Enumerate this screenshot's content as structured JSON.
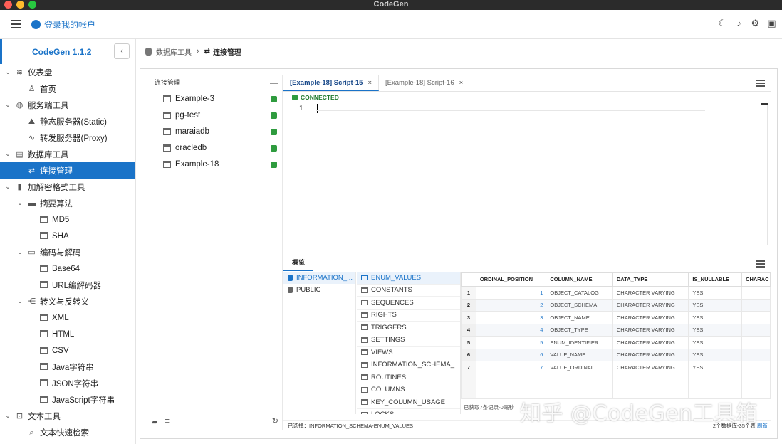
{
  "window": {
    "title": "CodeGen"
  },
  "colors": {
    "accent": "#1a73c8",
    "connected": "#2e9b3e"
  },
  "topbar": {
    "login_label": "登录我的帐户"
  },
  "sidebar": {
    "version": "CodeGen 1.1.2",
    "items": [
      {
        "label": "仪表盘",
        "level": 0,
        "icon": "layers-icon",
        "expanded": true
      },
      {
        "label": "首页",
        "level": 1,
        "icon": "user-icon"
      },
      {
        "label": "服务端工具",
        "level": 0,
        "icon": "globe-icon",
        "expanded": true
      },
      {
        "label": "静态服务器(Static)",
        "level": 1,
        "icon": "mountain-icon"
      },
      {
        "label": "转发服务器(Proxy)",
        "level": 1,
        "icon": "pulse-icon"
      },
      {
        "label": "数据库工具",
        "level": 0,
        "icon": "database-icon",
        "expanded": true
      },
      {
        "label": "连接管理",
        "level": 1,
        "icon": "swap-icon",
        "active": true
      },
      {
        "label": "加解密格式工具",
        "level": 0,
        "icon": "lock-icon",
        "expanded": true
      },
      {
        "label": "摘要算法",
        "level": 1,
        "icon": "key-icon",
        "expanded": true
      },
      {
        "label": "MD5",
        "level": 2,
        "icon": "document-icon"
      },
      {
        "label": "SHA",
        "level": 2,
        "icon": "document-icon"
      },
      {
        "label": "编码与解码",
        "level": 1,
        "icon": "keyboard-icon",
        "expanded": true
      },
      {
        "label": "Base64",
        "level": 2,
        "icon": "document-icon"
      },
      {
        "label": "URL编解码器",
        "level": 2,
        "icon": "document-icon"
      },
      {
        "label": "转义与反转义",
        "level": 1,
        "icon": "share-icon",
        "expanded": true
      },
      {
        "label": "XML",
        "level": 2,
        "icon": "document-icon"
      },
      {
        "label": "HTML",
        "level": 2,
        "icon": "document-icon"
      },
      {
        "label": "CSV",
        "level": 2,
        "icon": "document-icon"
      },
      {
        "label": "Java字符串",
        "level": 2,
        "icon": "document-icon"
      },
      {
        "label": "JSON字符串",
        "level": 2,
        "icon": "document-icon"
      },
      {
        "label": "JavaScript字符串",
        "level": 2,
        "icon": "document-icon"
      },
      {
        "label": "文本工具",
        "level": 0,
        "icon": "text-icon",
        "expanded": true
      },
      {
        "label": "文本快速检索",
        "level": 1,
        "icon": "search-icon"
      }
    ]
  },
  "breadcrumb": {
    "parent": "数据库工具",
    "current": "连接管理"
  },
  "connections": {
    "header": "连接管理",
    "items": [
      "Example-3",
      "pg-test",
      "maraiadb",
      "oracledb",
      "Example-18"
    ]
  },
  "editor": {
    "tabs": [
      "[Example-18] Script-15",
      "[Example-18] Script-16"
    ],
    "status": "CONNECTED",
    "line_number": "1"
  },
  "results": {
    "tab": "概览",
    "schemas": [
      "INFORMATION_...",
      "PUBLIC"
    ],
    "tables": [
      "ENUM_VALUES",
      "CONSTANTS",
      "SEQUENCES",
      "RIGHTS",
      "TRIGGERS",
      "SETTINGS",
      "VIEWS",
      "INFORMATION_SCHEMA_...",
      "ROUTINES",
      "COLUMNS",
      "KEY_COLUMN_USAGE",
      "LOCKS"
    ],
    "columns": [
      "ORDINAL_POSITION",
      "COLUMN_NAME",
      "DATA_TYPE",
      "IS_NULLABLE",
      "CHARAC"
    ],
    "rows": [
      [
        "1",
        "1",
        "OBJECT_CATALOG",
        "CHARACTER VARYING",
        "YES"
      ],
      [
        "2",
        "2",
        "OBJECT_SCHEMA",
        "CHARACTER VARYING",
        "YES"
      ],
      [
        "3",
        "3",
        "OBJECT_NAME",
        "CHARACTER VARYING",
        "YES"
      ],
      [
        "4",
        "4",
        "OBJECT_TYPE",
        "CHARACTER VARYING",
        "YES"
      ],
      [
        "5",
        "5",
        "ENUM_IDENTIFIER",
        "CHARACTER VARYING",
        "YES"
      ],
      [
        "6",
        "6",
        "VALUE_NAME",
        "CHARACTER VARYING",
        "YES"
      ],
      [
        "7",
        "7",
        "VALUE_ORDINAL",
        "CHARACTER VARYING",
        "YES"
      ]
    ],
    "fetch_info": "已获取7条记录-0毫秒",
    "selected": "已选择：INFORMATION_SCHEMA-ENUM_VALUES",
    "summary": "2个数据库-35个表",
    "refresh": "刷新"
  },
  "watermark": "知乎 @CodeGen工具箱"
}
